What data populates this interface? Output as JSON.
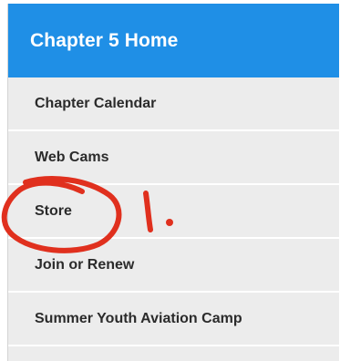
{
  "menu": {
    "header": "Chapter 5 Home",
    "items": [
      {
        "label": "Chapter Calendar"
      },
      {
        "label": "Web Cams"
      },
      {
        "label": "Store"
      },
      {
        "label": "Join or Renew"
      },
      {
        "label": "Summer Youth Aviation Camp"
      }
    ]
  },
  "annotation": {
    "mark": "1.",
    "color": "#e0301e"
  },
  "colors": {
    "header_bg": "#1f8fe6",
    "item_bg": "#ececec",
    "divider": "#ffffff"
  }
}
